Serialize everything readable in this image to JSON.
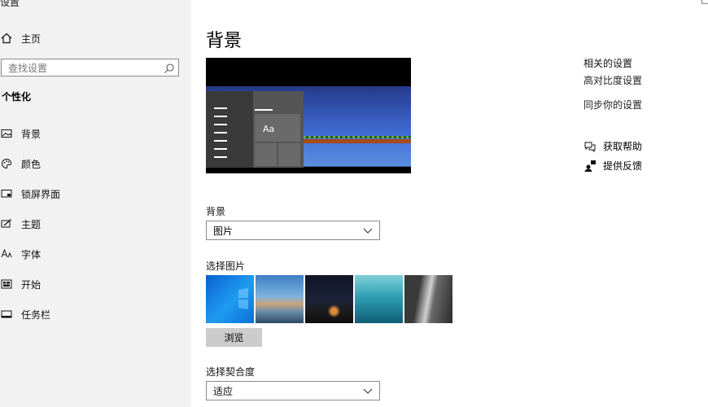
{
  "window": {
    "title": "设置",
    "minimize": "–",
    "maximize": "□"
  },
  "sidebar": {
    "home": "主页",
    "search_placeholder": "查找设置",
    "section": "个性化",
    "items": [
      {
        "label": "背景",
        "icon": "picture-icon"
      },
      {
        "label": "颜色",
        "icon": "palette-icon"
      },
      {
        "label": "锁屏界面",
        "icon": "lockscreen-icon"
      },
      {
        "label": "主题",
        "icon": "theme-icon"
      },
      {
        "label": "字体",
        "icon": "font-icon"
      },
      {
        "label": "开始",
        "icon": "start-icon"
      },
      {
        "label": "任务栏",
        "icon": "taskbar-icon"
      }
    ]
  },
  "main": {
    "title": "背景",
    "preview_sample": "Aa",
    "background_label": "背景",
    "background_value": "图片",
    "choose_picture_label": "选择图片",
    "browse": "浏览",
    "fit_label": "选择契合度",
    "fit_value": "适应"
  },
  "related": {
    "title": "相关的设置",
    "links": [
      "高对比度设置",
      "同步你的设置"
    ]
  },
  "help": {
    "get_help": "获取帮助",
    "feedback": "提供反馈"
  },
  "colors": {
    "sidebar_bg": "#f2f2f2",
    "button_bg": "#cccccc"
  }
}
